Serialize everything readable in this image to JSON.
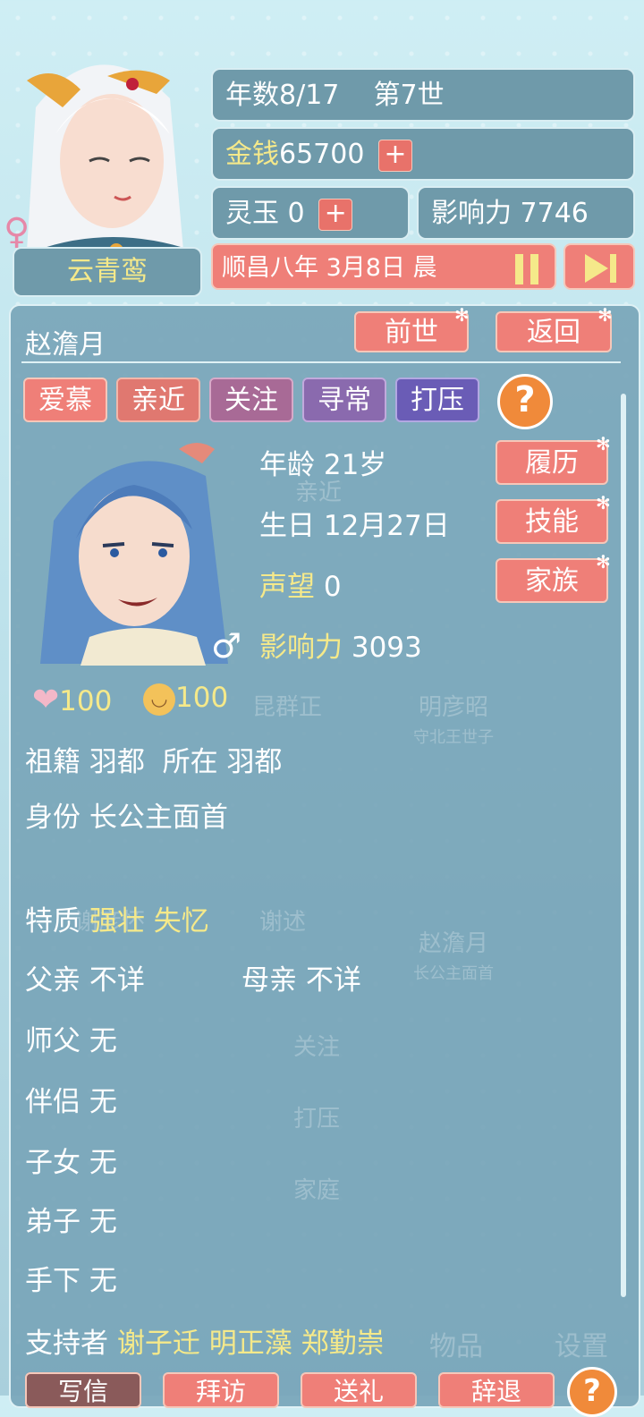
{
  "player": {
    "name": "云青鸾",
    "year_label": "年数8/17",
    "life_label": "第7世",
    "money_label": "金钱",
    "money_value": "65700",
    "jade_label": "灵玉",
    "jade_value": "0",
    "influence_label": "影响力",
    "influence_value": "7746",
    "plus": "+",
    "date": "顺昌八年 3月8日 晨"
  },
  "npc": {
    "name": "赵澹月",
    "buttons": {
      "past_life": "前世",
      "back": "返回",
      "resume": "履历",
      "skills": "技能",
      "family": "家族"
    },
    "relations": [
      "爱慕",
      "亲近",
      "关注",
      "寻常",
      "打压"
    ],
    "help": "?",
    "age_label": "年龄",
    "age_value": "21岁",
    "birthday_label": "生日",
    "birthday_value": "12月27日",
    "prestige_label": "声望",
    "prestige_value": "0",
    "influence_label": "影响力",
    "influence_value": "3093",
    "heart_value": "100",
    "mood_value": "100",
    "origin_label": "祖籍",
    "origin_value": "羽都",
    "location_label": "所在",
    "location_value": "羽都",
    "identity_label": "身份",
    "identity_value": "长公主面首",
    "traits_label": "特质",
    "traits": "强壮 失忆",
    "father_label": "父亲",
    "father_value": "不详",
    "mother_label": "母亲",
    "mother_value": "不详",
    "master_label": "师父",
    "master_value": "无",
    "partner_label": "伴侣",
    "partner_value": "无",
    "children_label": "子女",
    "children_value": "无",
    "disciples_label": "弟子",
    "disciples_value": "无",
    "subordinates_label": "手下",
    "subordinates_value": "无",
    "supporters_label": "支持者",
    "supporters_value": "谢子迁 明正藻 郑勤崇"
  },
  "background_ghost": [
    "亲近",
    "昆群正",
    "明彦昭",
    "守北王世子",
    "谢彦怀",
    "谢述",
    "赵澹月",
    "长公主面首",
    "关注",
    "打压",
    "家庭",
    "物品",
    "设置"
  ],
  "bottom": [
    "写信",
    "拜访",
    "送礼",
    "辞退"
  ],
  "colors": {
    "accent": "#ef7f78",
    "panel": "#78a5b8",
    "gold": "#f5e98a"
  }
}
